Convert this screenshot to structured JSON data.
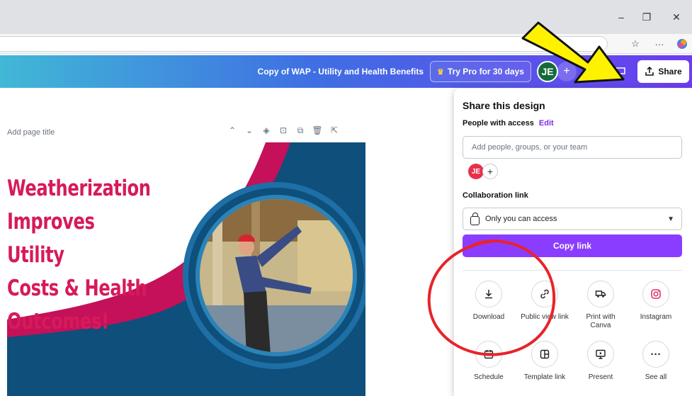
{
  "browser": {
    "window_controls": {
      "minimize": "–",
      "restore": "❐",
      "close": "✕"
    },
    "toolbar_icons": {
      "favorites": "☆",
      "more": "···"
    }
  },
  "header": {
    "design_title": "Copy of WAP - Utility and Health Benefits",
    "try_pro_label": "Try Pro for 30 days",
    "avatar_initials": "JE",
    "avatar_plus": "+",
    "share_label": "Share",
    "colors": {
      "gradient_start": "#41b8d6",
      "gradient_end": "#6c3df0",
      "avatar_bg": "#156a39"
    }
  },
  "editor": {
    "page_title_placeholder": "Add page title",
    "page_tools": [
      "⌃",
      "⌄",
      "◈",
      "⊡",
      "⧉",
      "🗑",
      "⇱"
    ]
  },
  "canvas": {
    "headline_lines": [
      "Weatherization",
      "Improves Utility",
      "Costs & Health",
      "Outcomes!"
    ],
    "colors": {
      "magenta": "#c4115a",
      "navy": "#0e4f7c",
      "headline": "#d71a5b"
    }
  },
  "share_panel": {
    "title": "Share this design",
    "people_label": "People with access",
    "edit_label": "Edit",
    "input_placeholder": "Add people, groups, or your team",
    "avatar_initials": "JE",
    "collab_label": "Collaboration link",
    "access_value": "Only you can access",
    "copy_link_label": "Copy link",
    "accent": "#8b3dff",
    "options_row1": [
      {
        "label": "Download",
        "icon": "download-icon"
      },
      {
        "label": "Public view link",
        "icon": "link-icon"
      },
      {
        "label": "Print with Canva",
        "icon": "print-truck-icon"
      },
      {
        "label": "Instagram",
        "icon": "instagram-icon"
      }
    ],
    "options_row2": [
      {
        "label": "Schedule",
        "icon": "calendar-icon"
      },
      {
        "label": "Template link",
        "icon": "template-icon"
      },
      {
        "label": "Present",
        "icon": "present-icon"
      },
      {
        "label": "See all",
        "icon": "more-icon"
      }
    ]
  }
}
